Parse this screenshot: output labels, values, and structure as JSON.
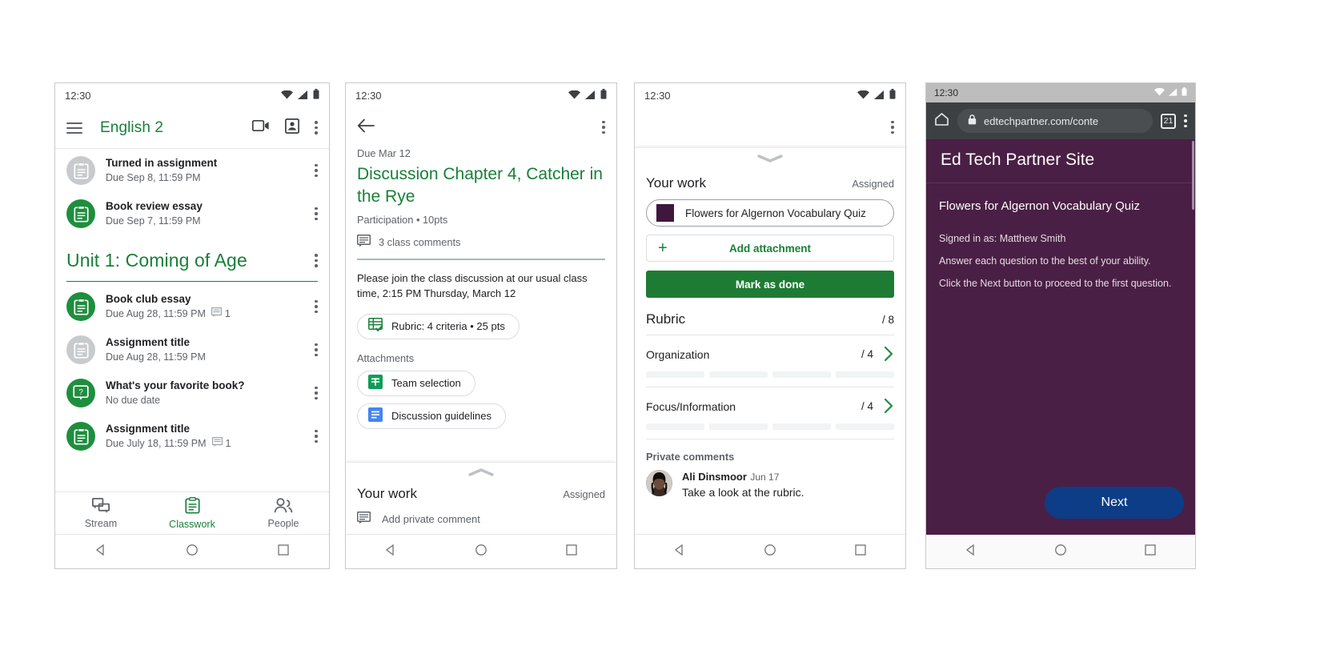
{
  "statusbar": {
    "time": "12:30"
  },
  "phone1": {
    "name": "classwork-screen",
    "appbar": {
      "title": "English 2",
      "menu_icon": "hamburger-icon",
      "meet_icon": "video-camera-icon",
      "card_icon": "class-card-icon",
      "overflow_icon": "kebab-menu-icon"
    },
    "top_items": [
      {
        "title": "Turned in assignment",
        "sub": "Due Sep 8, 11:59 PM",
        "icon": "assignment-icon",
        "state": "grey",
        "comments": ""
      },
      {
        "title": "Book review essay",
        "sub": "Due Sep 7, 11:59 PM",
        "icon": "assignment-icon",
        "state": "green",
        "comments": ""
      }
    ],
    "unit": {
      "title": "Unit 1: Coming of Age"
    },
    "unit_items": [
      {
        "title": "Book club essay",
        "sub": "Due Aug 28, 11:59 PM",
        "icon": "assignment-icon",
        "state": "green",
        "comments": "1"
      },
      {
        "title": "Assignment title",
        "sub": "Due Aug 28, 11:59 PM",
        "icon": "assignment-icon",
        "state": "grey",
        "comments": ""
      },
      {
        "title": "What's your favorite book?",
        "sub": "No due date",
        "icon": "question-icon",
        "state": "green",
        "comments": ""
      },
      {
        "title": "Assignment title",
        "sub": "Due July 18, 11:59 PM",
        "icon": "assignment-icon",
        "state": "green",
        "comments": "1"
      }
    ],
    "tabs": [
      {
        "label": "Stream",
        "icon": "stream-icon",
        "active": false
      },
      {
        "label": "Classwork",
        "icon": "classwork-icon",
        "active": true
      },
      {
        "label": "People",
        "icon": "people-icon",
        "active": false
      }
    ]
  },
  "phone2": {
    "name": "assignment-detail-screen",
    "appbar": {
      "back_icon": "back-arrow-icon",
      "overflow_icon": "kebab-menu-icon"
    },
    "due": "Due Mar 12",
    "title": "Discussion Chapter 4, Catcher in the Rye",
    "meta": "Participation • 10pts",
    "comments": "3 class comments",
    "description": "Please join the class discussion at our usual class time, 2:15 PM Thursday, March 12",
    "rubric_chip": "Rubric: 4 criteria • 25 pts",
    "attachments_label": "Attachments",
    "attachments": [
      {
        "label": "Team selection",
        "icon": "google-sheets-icon"
      },
      {
        "label": "Discussion guidelines",
        "icon": "google-docs-icon"
      }
    ],
    "work": {
      "title": "Your work",
      "status": "Assigned",
      "private_comment_placeholder": "Add private comment"
    }
  },
  "phone3": {
    "name": "your-work-sheet-screen",
    "appbar": {
      "overflow_icon": "kebab-menu-icon"
    },
    "work": {
      "title": "Your work",
      "status": "Assigned"
    },
    "attachment": {
      "label": "Flowers for Algernon Vocabulary Quiz",
      "thumb_color": "#3d173d"
    },
    "add_attachment": "Add attachment",
    "mark_done": "Mark as done",
    "rubric": {
      "title": "Rubric",
      "total": "/ 8"
    },
    "criteria": [
      {
        "name": "Organization",
        "points": "/ 4",
        "levels": 4
      },
      {
        "name": "Focus/Information",
        "points": "/ 4",
        "levels": 4
      }
    ],
    "private_comments_label": "Private comments",
    "comment": {
      "author": "Ali Dinsmoor",
      "date": "Jun 17",
      "text": "Take a look at the rubric."
    }
  },
  "phone4": {
    "name": "browser-quiz-screen",
    "toolbar": {
      "home_icon": "home-icon",
      "lock_icon": "lock-icon",
      "url": "edtechpartner.com/conte",
      "tab_count": "21",
      "overflow_icon": "kebab-menu-icon"
    },
    "site_title": "Ed Tech Partner Site",
    "quiz_title": "Flowers for Algernon Vocabulary Quiz",
    "lines": [
      "Signed in as: Matthew Smith",
      "Answer each question to the best of your ability.",
      "Click the Next button to proceed to the first question."
    ],
    "next_button": "Next",
    "colors": {
      "page_bg": "#4a1f45",
      "next_bg": "#0d3d86",
      "toolbar_bg": "#3c4043"
    }
  },
  "navbar": {
    "back_icon": "android-back-triangle-icon",
    "home_icon": "android-home-circle-icon",
    "recents_icon": "android-recents-square-icon"
  }
}
